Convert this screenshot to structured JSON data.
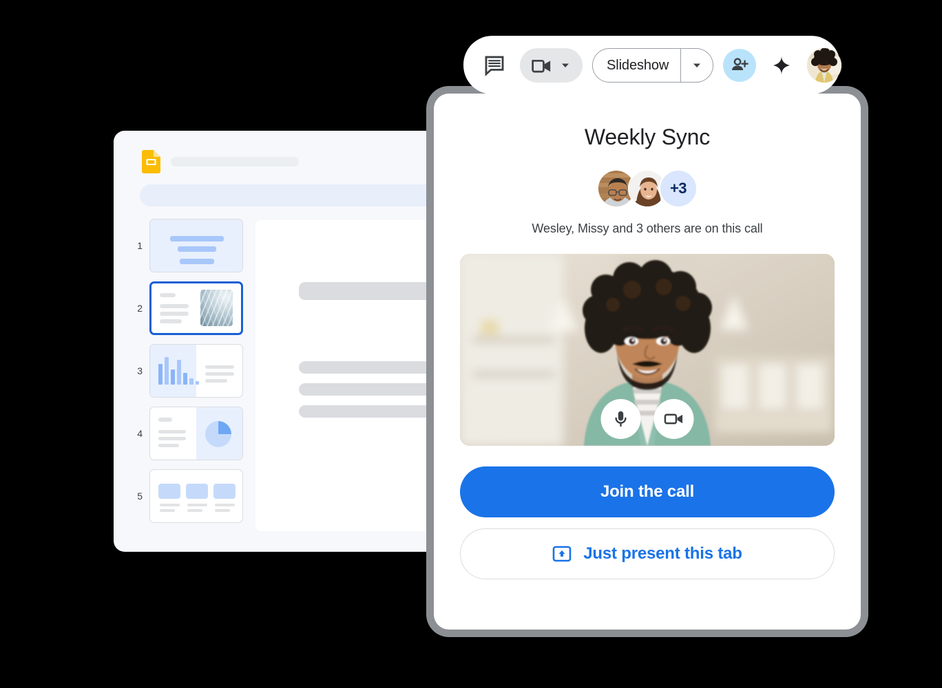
{
  "toolbar": {
    "chat_icon": "chat-bubble-icon",
    "camera_icon": "video-camera-icon",
    "camera_caret_icon": "chevron-down-icon",
    "slideshow_label": "Slideshow",
    "slideshow_caret_icon": "chevron-down-icon",
    "add_person_icon": "person-add-icon",
    "sparkle_icon": "sparkle-icon",
    "account_avatar": "user-avatar",
    "accent_add_bg": "#b9e3fb"
  },
  "meet_card": {
    "title": "Weekly Sync",
    "overflow_count": "+3",
    "participants_text": "Wesley, Missy and 3 others are on this call",
    "participants": [
      {
        "name": "Wesley",
        "avatar": "participant-avatar-wesley"
      },
      {
        "name": "Missy",
        "avatar": "participant-avatar-missy"
      }
    ],
    "video": {
      "self_view": "self-video-preview",
      "mic_icon": "microphone-icon",
      "camera_icon": "video-camera-icon"
    },
    "join_label": "Join the call",
    "present_label": "Just present this tab",
    "present_icon": "present-to-screen-icon",
    "primary_color": "#1a73e8"
  },
  "slides_window": {
    "app_icon": "google-slides-icon",
    "title_placeholder": "",
    "slides": [
      {
        "number": "1",
        "layout": "title-slide",
        "selected": false
      },
      {
        "number": "2",
        "layout": "text-and-image",
        "selected": true
      },
      {
        "number": "3",
        "layout": "bar-chart-and-text",
        "selected": false
      },
      {
        "number": "4",
        "layout": "text-and-pie-chart",
        "selected": false
      },
      {
        "number": "5",
        "layout": "three-cards",
        "selected": false
      }
    ]
  }
}
